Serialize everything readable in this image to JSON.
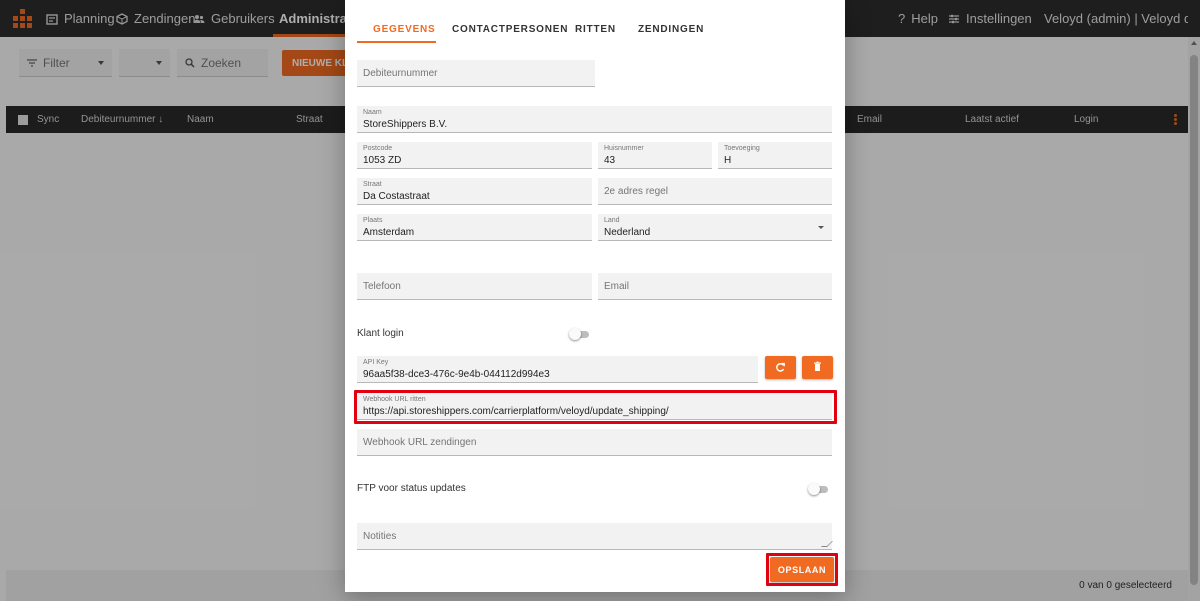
{
  "topbar": {
    "nav": [
      {
        "label": "Planning",
        "icon": "planning-icon"
      },
      {
        "label": "Zendingen",
        "icon": "box-icon"
      },
      {
        "label": "Gebruikers",
        "icon": "users-icon"
      },
      {
        "label": "Administratie",
        "icon": "admin-icon"
      }
    ],
    "help_label": "Help",
    "settings_label": "Instellingen",
    "user_label": "Veloyd (admin) | Veloyd demo"
  },
  "background": {
    "filter_label": "Filter",
    "second_select_value": "",
    "search_placeholder": "Zoeken",
    "new_button_label": "NIEUWE KLANT",
    "columns": [
      "Sync",
      "Debiteurnummer ↓",
      "Naam",
      "Straat",
      "Email",
      "Laatst actief",
      "Login"
    ],
    "selected_count": "0 van 0 geselecteerd"
  },
  "dialog": {
    "tabs": [
      "GEGEVENS",
      "CONTACTPERSONEN",
      "RITTEN",
      "ZENDINGEN"
    ],
    "active_tab": "GEGEVENS",
    "fields": {
      "debiteurnummer": {
        "label": "Debiteurnummer",
        "value": ""
      },
      "naam": {
        "label": "Naam",
        "value": "StoreShippers B.V."
      },
      "postcode": {
        "label": "Postcode",
        "value": "1053 ZD"
      },
      "huisnummer": {
        "label": "Huisnummer",
        "value": "43"
      },
      "toevoeging": {
        "label": "Toevoeging",
        "value": "H"
      },
      "straat": {
        "label": "Straat",
        "value": "Da Costastraat"
      },
      "adres2": {
        "label": "2e adres regel",
        "value": ""
      },
      "plaats": {
        "label": "Plaats",
        "value": "Amsterdam"
      },
      "land": {
        "label": "Land",
        "value": "Nederland"
      },
      "telefoon": {
        "label": "Telefoon",
        "value": ""
      },
      "email": {
        "label": "Email",
        "value": ""
      },
      "api_key": {
        "label": "API Key",
        "value": "96aa5f38-dce3-476c-9e4b-044112d994e3"
      },
      "webhook_ritten": {
        "label": "Webhook URL ritten",
        "value": "https://api.storeshippers.com/carrierplatform/veloyd/update_shipping/"
      },
      "webhook_zendingen": {
        "label": "Webhook URL zendingen",
        "value": ""
      },
      "notities": {
        "label": "Notities",
        "value": ""
      }
    },
    "klant_login_label": "Klant login",
    "klant_login_on": false,
    "ftp_label": "FTP voor status updates",
    "ftp_on": false,
    "save_label": "OPSLAAN"
  },
  "colors": {
    "accent": "#f16a21",
    "topbar": "#2d2d2d",
    "highlight": "#e0000f"
  }
}
